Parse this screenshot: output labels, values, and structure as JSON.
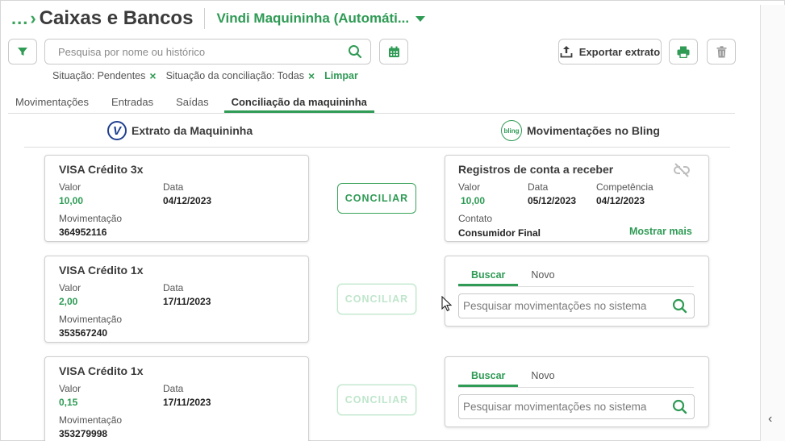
{
  "header": {
    "breadcrumb_ellipsis": "...",
    "title": "Caixas e Bancos",
    "account": "Vindi Maquininha (Automáti..."
  },
  "toolbar": {
    "search_placeholder": "Pesquisa por nome ou histórico",
    "export_label": "Exportar extrato"
  },
  "filters": {
    "items": [
      "Situação: Pendentes",
      "Situação da conciliação: Todas"
    ],
    "clear_label": "Limpar"
  },
  "tabs": [
    "Movimentações",
    "Entradas",
    "Saídas",
    "Conciliação da maquininha"
  ],
  "columns": {
    "left": "Extrato da Maquininha",
    "right": "Movimentações no Bling",
    "left_logo": "V",
    "right_logo": "bling"
  },
  "labels": {
    "valor": "Valor",
    "data": "Data",
    "movimentacao": "Movimentação",
    "competencia": "Competência",
    "contato": "Contato",
    "conciliar": "CONCILIAR",
    "buscar": "Buscar",
    "novo": "Novo",
    "sys_search_placeholder": "Pesquisar movimentações no sistema",
    "mostrar_mais": "Mostrar mais"
  },
  "transactions": [
    {
      "title": "VISA Crédito 3x",
      "valor": "10,00",
      "data": "04/12/2023",
      "movimentacao": "364952116"
    },
    {
      "title": "VISA Crédito 1x",
      "valor": "2,00",
      "data": "17/11/2023",
      "movimentacao": "353567240"
    },
    {
      "title": "VISA Crédito 1x",
      "valor": "0,15",
      "data": "17/11/2023",
      "movimentacao": "353279998"
    }
  ],
  "match": {
    "title": "Registros de conta a receber",
    "valor": "10,00",
    "data": "05/12/2023",
    "competencia": "04/12/2023",
    "contato": "Consumidor Final"
  },
  "colors": {
    "accent": "#2f9b55",
    "text": "#3b3b3b",
    "border": "#cfcfcf"
  }
}
